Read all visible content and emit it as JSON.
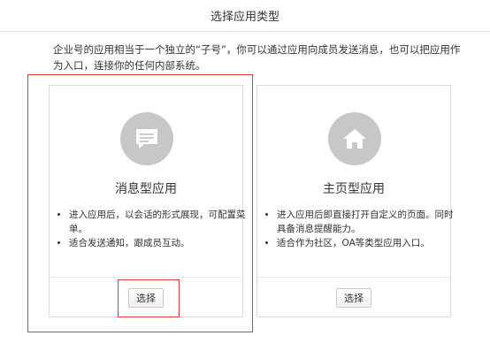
{
  "dialog": {
    "title": "选择应用类型",
    "intro": "企业号的应用相当于一个独立的“子号”，你可以通过应用向成员发送消息，也可以把应用作为入口，连接你的任何内部系统。"
  },
  "cards": [
    {
      "title": "消息型应用",
      "icon": "message-icon",
      "bullets": [
        "进入应用后，以会话的形式展现，可配置菜单。",
        "适合发送通知，跟成员互动。"
      ],
      "button_label": "选择"
    },
    {
      "title": "主页型应用",
      "icon": "home-icon",
      "bullets": [
        "进入应用后即直接打开自定义的页面。同时具备消息提醒能力。",
        "适合作为社区，OA等类型应用入口。"
      ],
      "button_label": "选择"
    }
  ],
  "colors": {
    "highlight": "#e53935",
    "icon_bg": "#c7c7c7",
    "border": "#dcdcdc"
  }
}
